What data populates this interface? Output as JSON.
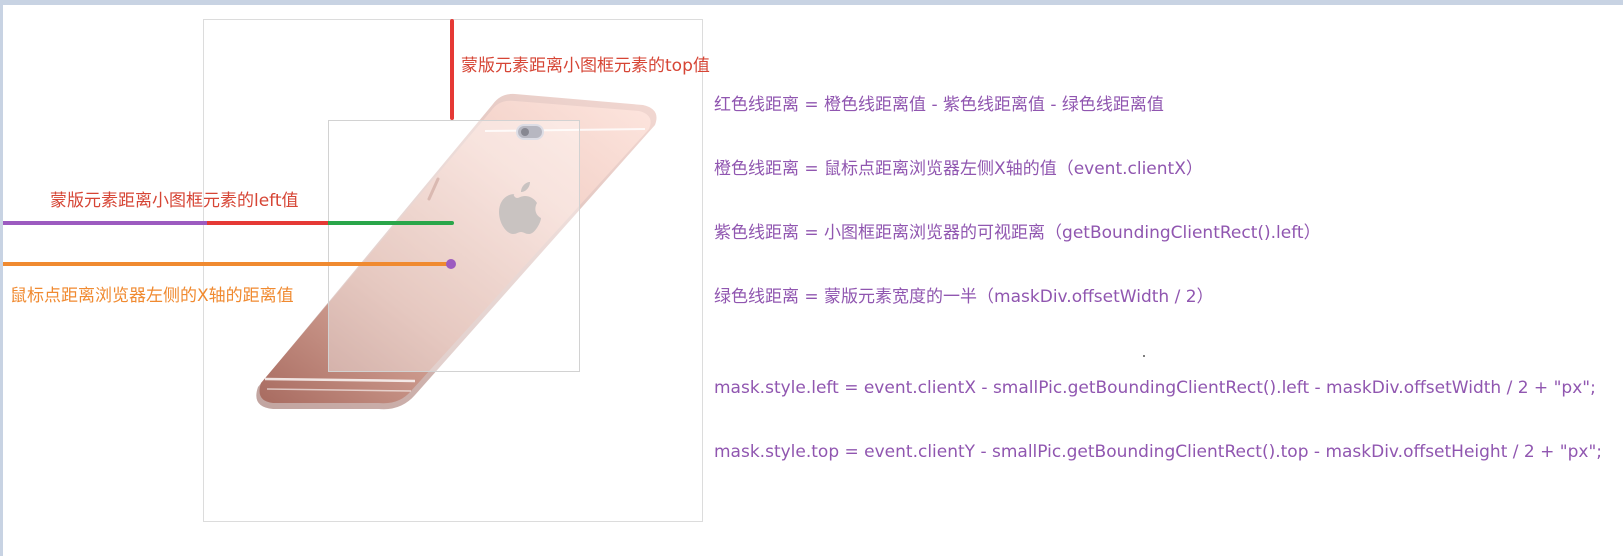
{
  "annotations": {
    "top_label": "蒙版元素距离小图框元素的top值",
    "left_label": "蒙版元素距离小图框元素的left值",
    "mouse_label": "鼠标点距离浏览器左侧的X轴的距离值"
  },
  "formulas": [
    "红色线距离 = 橙色线距离值 - 紫色线距离值 - 绿色线距离值",
    "橙色线距离 = 鼠标点距离浏览器左侧X轴的值（event.clientX）",
    "紫色线距离 = 小图框距离浏览器的可视距离（getBoundingClientRect().left）",
    "绿色线距离 = 蒙版元素宽度的一半（maskDiv.offsetWidth / 2）"
  ],
  "code": [
    "mask.style.left = event.clientX - smallPic.getBoundingClientRect().left - maskDiv.offsetWidth / 2 + \"px\";",
    "mask.style.top = event.clientY - smallPic.getBoundingClientRect().top - maskDiv.offsetHeight / 2 + \"px\";"
  ],
  "colors": {
    "red": "#e53935",
    "orange": "#f08a30",
    "purple": "#9c5bc0",
    "green": "#2aa64a",
    "formula_text": "#9056b0"
  },
  "icons": {
    "product": "phone-product-icon",
    "brand": "apple-logo-icon"
  }
}
